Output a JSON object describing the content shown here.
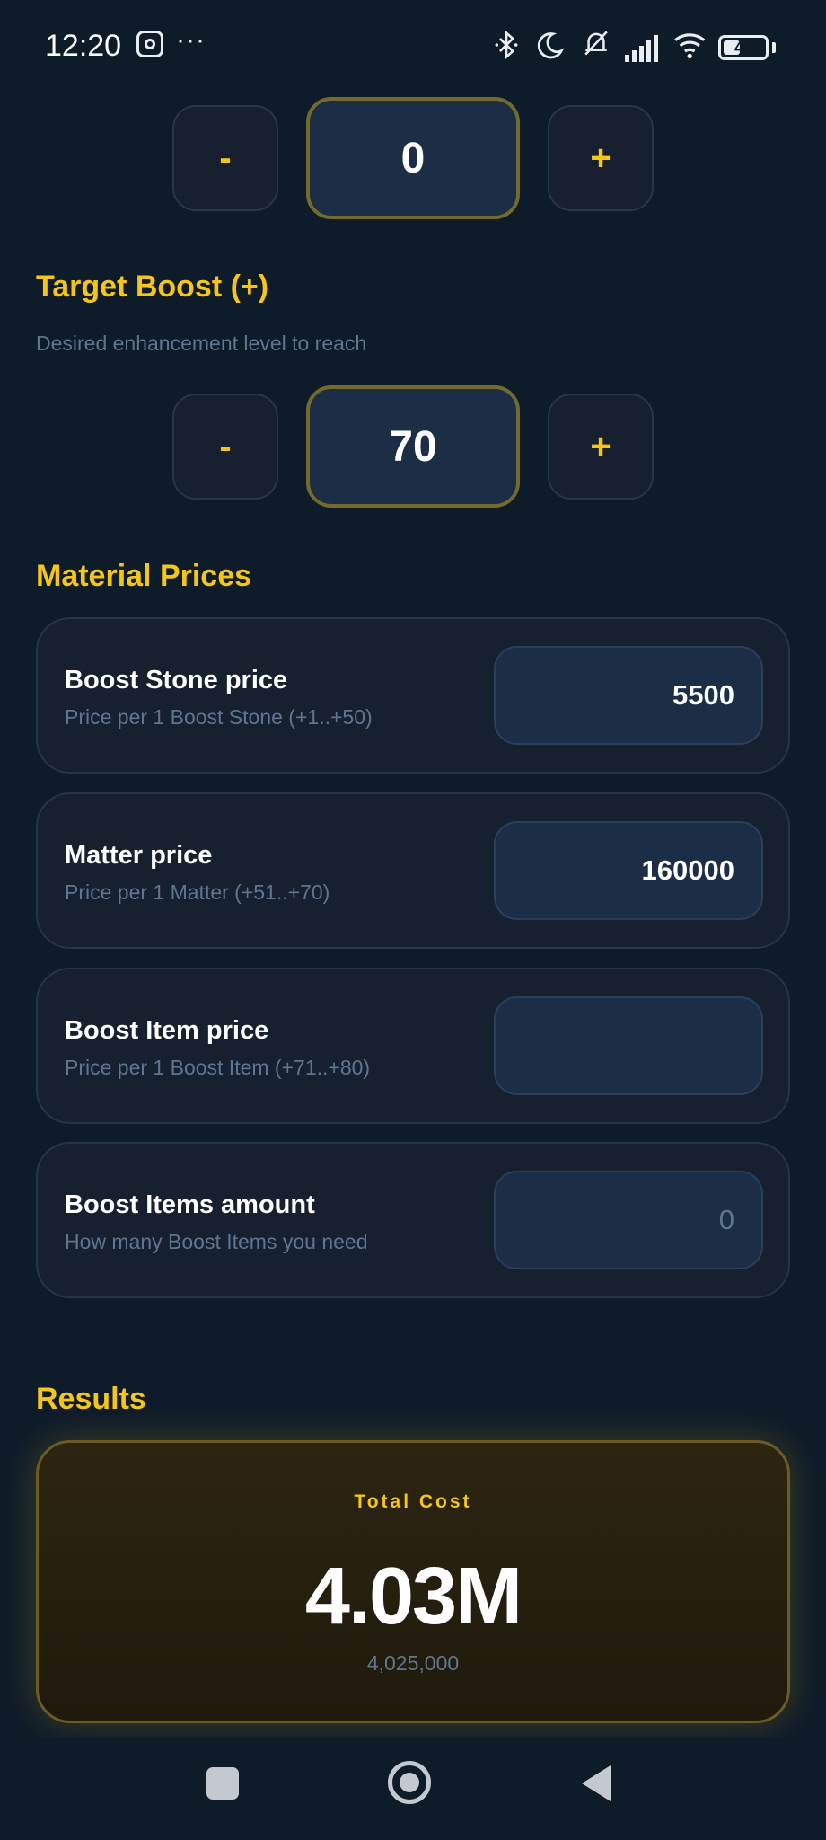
{
  "status_bar": {
    "time": "12:20",
    "more_dots": "···",
    "battery_level": "40",
    "battery_fraction": 0.4,
    "icons": [
      "instagram-icon",
      "bluetooth-icon",
      "moon-icon",
      "bell-off-icon",
      "signal-icon",
      "wifi-icon",
      "battery-icon"
    ]
  },
  "current_boost": {
    "minus_label": "-",
    "value": "0",
    "plus_label": "+"
  },
  "target_boost": {
    "title": "Target Boost (+)",
    "subtitle": "Desired enhancement level to reach",
    "minus_label": "-",
    "value": "70",
    "plus_label": "+"
  },
  "material_prices": {
    "title": "Material Prices",
    "items": [
      {
        "title": "Boost Stone price",
        "subtitle": "Price per 1 Boost Stone (+1..+50)",
        "value": "5500",
        "placeholder": ""
      },
      {
        "title": "Matter price",
        "subtitle": "Price per 1 Matter (+51..+70)",
        "value": "160000",
        "placeholder": ""
      },
      {
        "title": "Boost Item price",
        "subtitle": "Price per 1 Boost Item (+71..+80)",
        "value": "",
        "placeholder": ""
      },
      {
        "title": "Boost Items amount",
        "subtitle": "How many Boost Items you need",
        "value": "",
        "placeholder": "0"
      }
    ]
  },
  "results": {
    "title": "Results",
    "label": "Total Cost",
    "value": "4.03M",
    "exact": "4,025,000"
  },
  "colors": {
    "background": "#0e1b29",
    "accent": "#f5c518",
    "card": "#17202f",
    "input": "#1c2e46",
    "muted_text": "#5f7690"
  }
}
